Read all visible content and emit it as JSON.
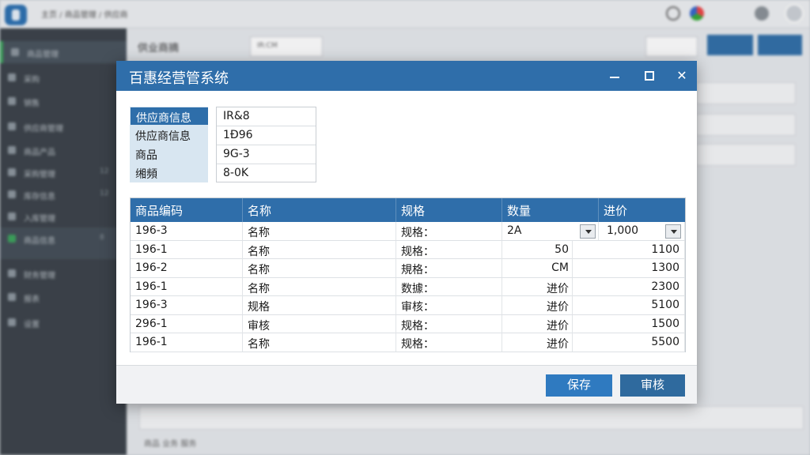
{
  "dialog": {
    "title": "百惠经营管系统",
    "info_labels": [
      "供应商信息",
      "供应商信息",
      "商品",
      "缃頻"
    ],
    "info_values": [
      "IR&8",
      "1Đ96",
      "9G-3",
      "8-0K"
    ],
    "table": {
      "headers": [
        "商品编码",
        "名称",
        "规格",
        "数量",
        "进价"
      ],
      "rows": [
        {
          "code": "196-3",
          "name": "名称",
          "spec": "规格：",
          "qty": "2A",
          "price": "1,000",
          "editing": true
        },
        {
          "code": "196-1",
          "name": "名称",
          "spec": "规格：",
          "qty": "50",
          "price": "1100"
        },
        {
          "code": "196-2",
          "name": "名称",
          "spec": "規格：",
          "qty": "CM",
          "price": "1300"
        },
        {
          "code": "196-1",
          "name": "名称",
          "spec": "数據：",
          "qty": "进价",
          "price": "2300"
        },
        {
          "code": "196-3",
          "name": "规格",
          "spec": "审核：",
          "qty": "进价",
          "price": "5100"
        },
        {
          "code": "296-1",
          "name": "审核",
          "spec": "规格：",
          "qty": "进价",
          "price": "1500"
        },
        {
          "code": "196-1",
          "name": "名称",
          "spec": "规格：",
          "qty": "进价",
          "price": "5500"
        }
      ]
    },
    "buttons": {
      "save": "保存",
      "audit": "审核"
    }
  },
  "background": {
    "breadcrumb": "主页 / 商品管理 / 供应商",
    "page_title": "供业商摘",
    "filter_select": "IR:CM",
    "sidebar": [
      {
        "label": "商品管理",
        "count": ""
      },
      {
        "label": "采购",
        "count": ""
      },
      {
        "label": "销售",
        "count": ""
      },
      {
        "label": "供应商管理",
        "count": ""
      },
      {
        "label": "商品产品",
        "count": ""
      },
      {
        "label": "采购管理",
        "count": "12"
      },
      {
        "label": "库存信息",
        "count": "12"
      },
      {
        "label": "入库管理",
        "count": ""
      },
      {
        "label": "商品信息",
        "count": "8"
      },
      {
        "label": "财务管理",
        "count": ""
      },
      {
        "label": "报表",
        "count": ""
      },
      {
        "label": "设置",
        "count": ""
      }
    ],
    "footer": "商品 业务 服务"
  },
  "colors": {
    "accent": "#2f6eaa",
    "save": "#2f7ac0",
    "audit": "#2f6a9e",
    "sidebar": "#3a4148"
  }
}
